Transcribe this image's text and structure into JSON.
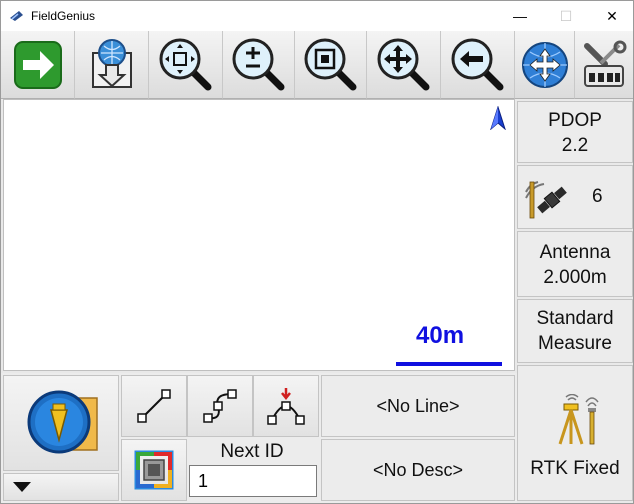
{
  "window": {
    "title": "FieldGenius",
    "minimize": "—",
    "maximize": "☐",
    "close": "✕"
  },
  "toolbar": {
    "icons": [
      "next-arrow-icon",
      "download-arrow-icon",
      "zoom-extents-icon",
      "zoom-in-out-icon",
      "zoom-window-icon",
      "pan-icon",
      "zoom-previous-icon",
      "globe-navigate-icon",
      "tools-settings-icon"
    ]
  },
  "map": {
    "scale_label": "40m",
    "north_color": "#1a3fd0"
  },
  "status": {
    "pdop_label": "PDOP",
    "pdop_value": "2.2",
    "satellites": "6",
    "antenna_label": "Antenna",
    "antenna_value": "2.000m",
    "measure_line1": "Standard",
    "measure_line2": "Measure",
    "rtk_status": "RTK Fixed"
  },
  "bottom": {
    "line_button": "<No Line>",
    "desc_button": "<No Desc>",
    "next_id_label": "Next ID",
    "next_id_value": "1"
  },
  "colors": {
    "accent_blue": "#1010e0",
    "green": "#2e9a2e"
  }
}
